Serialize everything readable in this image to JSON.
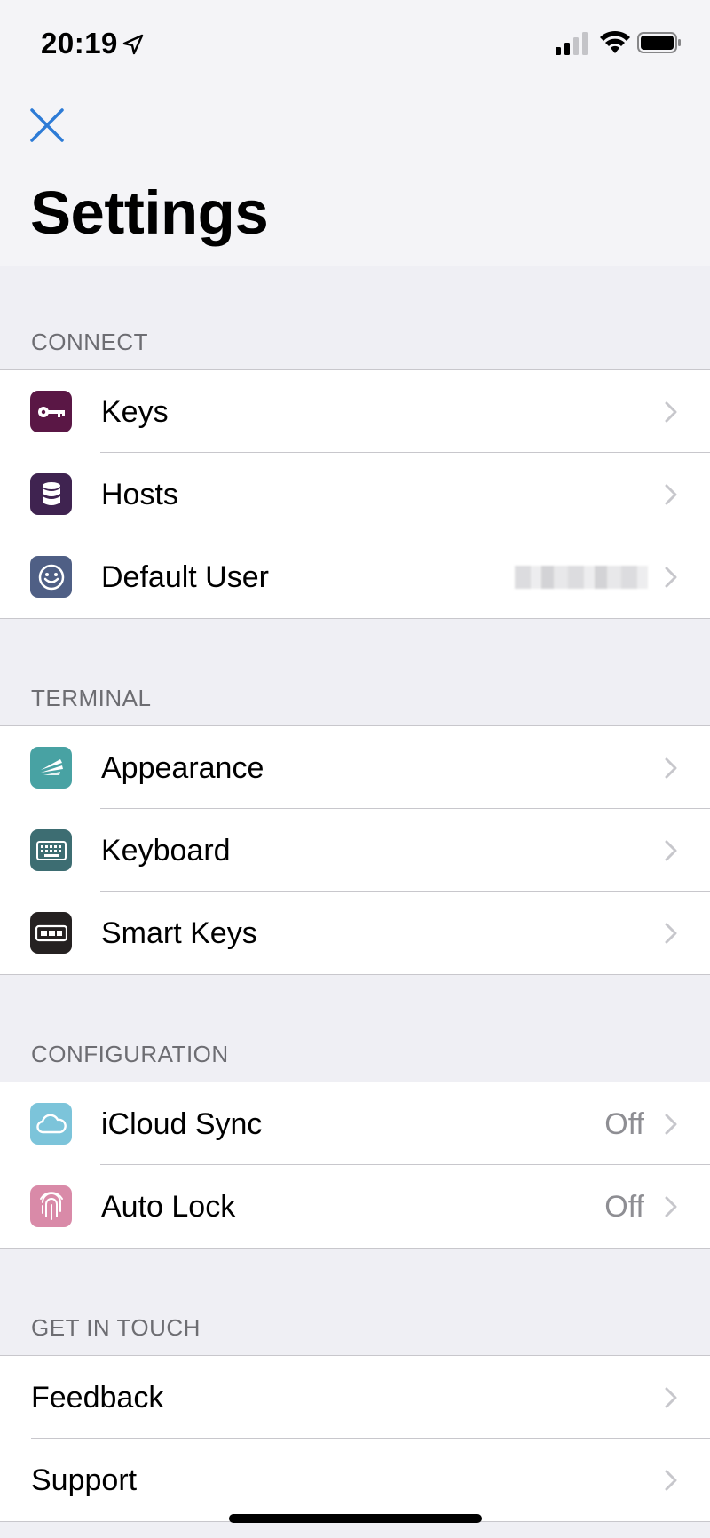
{
  "status_bar": {
    "time": "20:19"
  },
  "nav": {
    "title": "Settings"
  },
  "sections": [
    {
      "header": "CONNECT",
      "rows": [
        {
          "label": "Keys",
          "icon": "key-icon",
          "icon_bg": "#5a1745"
        },
        {
          "label": "Hosts",
          "icon": "database-icon",
          "icon_bg": "#3f2350"
        },
        {
          "label": "Default User",
          "icon": "smiley-icon",
          "icon_bg": "#4f5f85"
        }
      ]
    },
    {
      "header": "TERMINAL",
      "rows": [
        {
          "label": "Appearance",
          "icon": "brush-icon",
          "icon_bg": "#48a2a3"
        },
        {
          "label": "Keyboard",
          "icon": "keyboard-icon",
          "icon_bg": "#3d6d72"
        },
        {
          "label": "Smart Keys",
          "icon": "smart-keys-icon",
          "icon_bg": "#252121"
        }
      ]
    },
    {
      "header": "CONFIGURATION",
      "rows": [
        {
          "label": "iCloud Sync",
          "value": "Off",
          "icon": "cloud-icon",
          "icon_bg": "#7cc4da"
        },
        {
          "label": "Auto Lock",
          "value": "Off",
          "icon": "fingerprint-icon",
          "icon_bg": "#d98aa8"
        }
      ]
    },
    {
      "header": "GET IN TOUCH",
      "rows": [
        {
          "label": "Feedback"
        },
        {
          "label": "Support"
        }
      ]
    }
  ],
  "colors": {
    "accent": "#2d7bd6",
    "chevron": "#c7c7cc",
    "secondary_text": "#8e8e93"
  }
}
